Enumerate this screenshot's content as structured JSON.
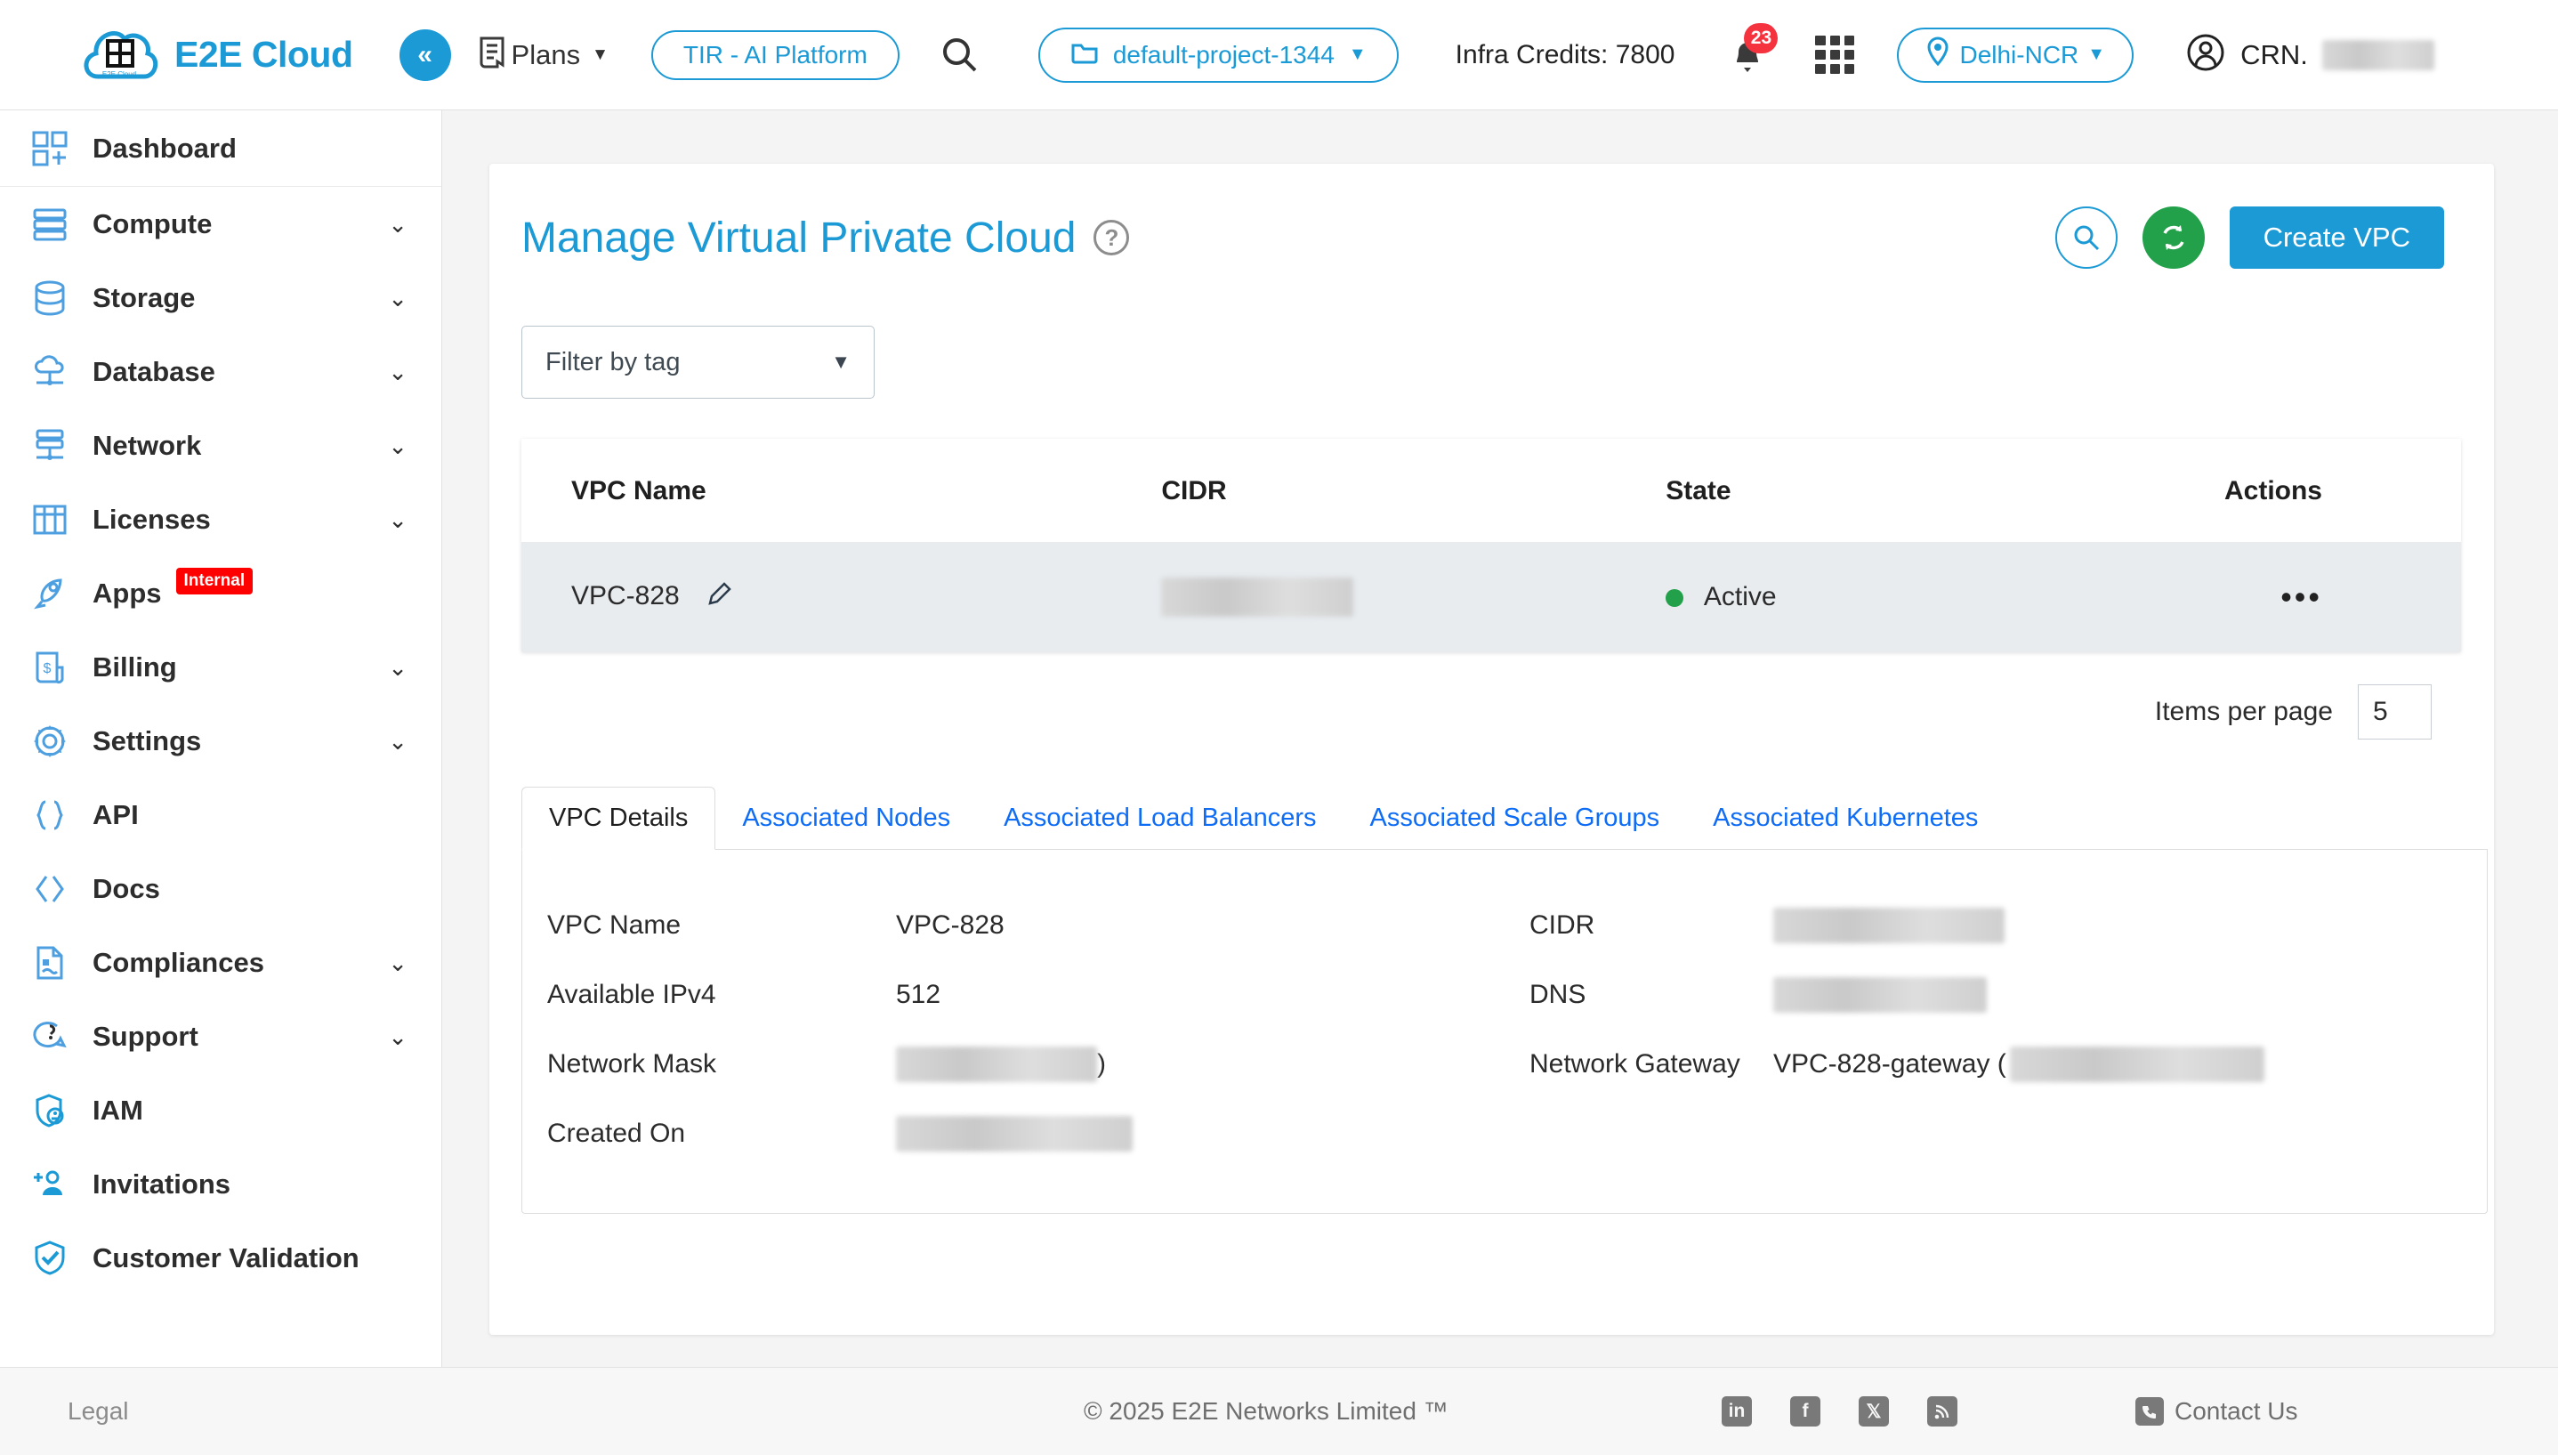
{
  "header": {
    "brand": "E2E Cloud",
    "logo_caption": "E2E Cloud",
    "collapse_label": "«",
    "plans_label": "Plans",
    "tir_label": "TIR - AI Platform",
    "project_label": "default-project-1344",
    "credits_label": "Infra Credits: 7800",
    "notification_count": "23",
    "region_label": "Delhi-NCR",
    "user_label": "CRN."
  },
  "sidebar": {
    "items": [
      {
        "label": "Dashboard",
        "icon": "dashboard-icon",
        "expandable": false
      },
      {
        "label": "Compute",
        "icon": "server-icon",
        "expandable": true
      },
      {
        "label": "Storage",
        "icon": "database-icon",
        "expandable": true
      },
      {
        "label": "Database",
        "icon": "cloud-db-icon",
        "expandable": true
      },
      {
        "label": "Network",
        "icon": "network-icon",
        "expandable": true
      },
      {
        "label": "Licenses",
        "icon": "license-icon",
        "expandable": true
      },
      {
        "label": "Apps",
        "icon": "rocket-icon",
        "expandable": false,
        "tag": "Internal"
      },
      {
        "label": "Billing",
        "icon": "billing-icon",
        "expandable": true
      },
      {
        "label": "Settings",
        "icon": "gear-icon",
        "expandable": true
      },
      {
        "label": "API",
        "icon": "braces-icon",
        "expandable": false
      },
      {
        "label": "Docs",
        "icon": "code-icon",
        "expandable": false
      },
      {
        "label": "Compliances",
        "icon": "document-icon",
        "expandable": true
      },
      {
        "label": "Support",
        "icon": "support-icon",
        "expandable": true
      },
      {
        "label": "IAM",
        "icon": "shield-user-icon",
        "expandable": false
      },
      {
        "label": "Invitations",
        "icon": "add-user-icon",
        "expandable": false
      },
      {
        "label": "Customer Validation",
        "icon": "shield-check-icon",
        "expandable": false
      }
    ]
  },
  "main": {
    "page_title": "Manage Virtual Private Cloud",
    "create_button": "Create VPC",
    "filter_placeholder": "Filter by tag",
    "table": {
      "columns": [
        "VPC Name",
        "CIDR",
        "State",
        "Actions"
      ],
      "rows": [
        {
          "name": "VPC-828",
          "cidr": "",
          "state": "Active",
          "actions": "•••"
        }
      ]
    },
    "items_per_page_label": "Items per page",
    "items_per_page_value": "5",
    "tabs": [
      {
        "label": "VPC Details",
        "active": true
      },
      {
        "label": "Associated Nodes",
        "active": false
      },
      {
        "label": "Associated Load Balancers",
        "active": false
      },
      {
        "label": "Associated Scale Groups",
        "active": false
      },
      {
        "label": "Associated Kubernetes",
        "active": false
      }
    ],
    "details": {
      "left": [
        {
          "label": "VPC Name",
          "value": "VPC-828",
          "redacted": false
        },
        {
          "label": "Available IPv4",
          "value": "512",
          "redacted": false
        },
        {
          "label": "Network Mask",
          "value": ")",
          "redacted": true,
          "redact_width": 113
        },
        {
          "label": "Created On",
          "value": "",
          "redacted": true,
          "redact_width": 133
        }
      ],
      "right": [
        {
          "label": "CIDR",
          "value": "",
          "redacted": true,
          "redact_width": 130
        },
        {
          "label": "DNS",
          "value": "",
          "redacted": true,
          "redact_width": 120
        },
        {
          "label": "Network Gateway",
          "value": "VPC-828-gateway (",
          "redacted": true,
          "redact_width": 143
        }
      ]
    }
  },
  "footer": {
    "legal": "Legal",
    "copyright": "© 2025 E2E Networks Limited ™",
    "socials": [
      "linkedin-icon",
      "facebook-icon",
      "x-icon",
      "rss-icon"
    ],
    "contact": "Contact Us"
  },
  "colors": {
    "brand_blue": "#1b9ad6",
    "link_blue": "#0e6cf5",
    "green": "#22a04a",
    "red": "#ff0000",
    "badge_red": "#f5333f"
  }
}
